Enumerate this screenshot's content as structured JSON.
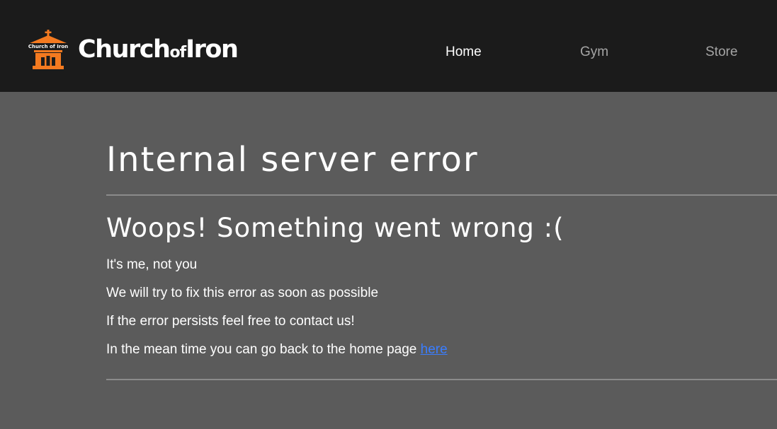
{
  "header": {
    "brand": {
      "logo_text": "Church of Iron",
      "name_part1": "Church",
      "name_part2": "of",
      "name_part3": "Iron",
      "logo_icon": "church-icon",
      "logo_color": "#f47a20"
    },
    "nav": [
      {
        "label": "Home",
        "active": true
      },
      {
        "label": "Gym",
        "active": false
      },
      {
        "label": "Store",
        "active": false
      }
    ]
  },
  "main": {
    "title": "Internal server error",
    "subtitle": "Woops! Something went wrong :(",
    "lines": [
      "It's me, not you",
      "We will try to fix this error as soon as possible",
      "If the error persists feel free to contact us!",
      "In the mean time you can go back to the home page"
    ],
    "link_label": "here"
  },
  "colors": {
    "header_bg": "#1b1b1b",
    "page_bg": "#5b5b5b",
    "link": "#3a7dff",
    "nav_inactive": "#a5a5a5"
  }
}
